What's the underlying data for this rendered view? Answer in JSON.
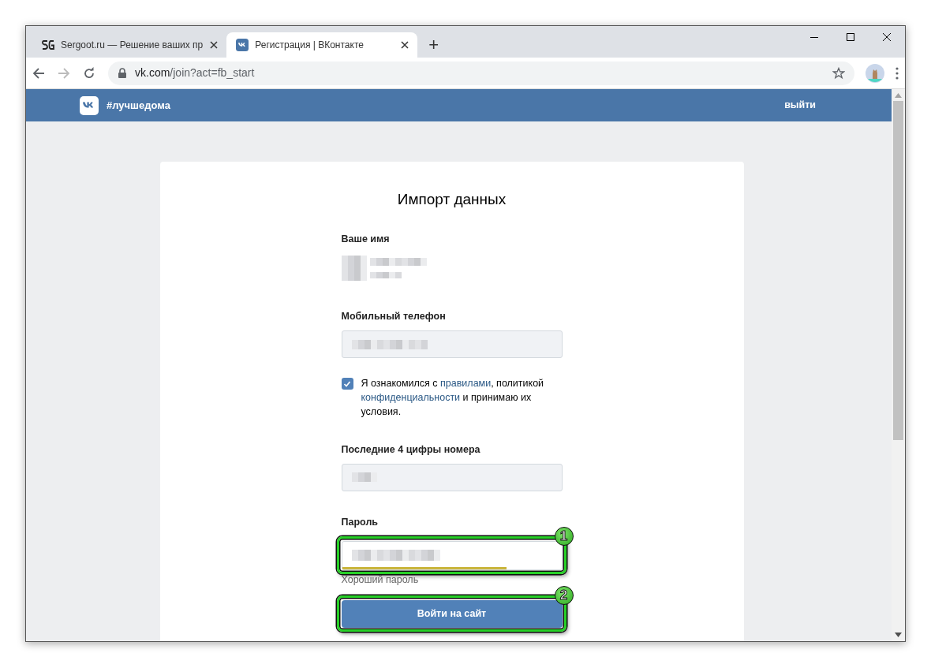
{
  "browser": {
    "tabs": [
      {
        "title": "Sergoot.ru — Решение ваших пр",
        "selected": false,
        "kind": "sg"
      },
      {
        "title": "Регистрация | ВКонтакте",
        "selected": true,
        "kind": "vk"
      }
    ],
    "new_tab": "+",
    "url_host": "vk.com",
    "url_path": "/join?act=fb_start"
  },
  "header": {
    "tag": "#лучшедома",
    "logout": "выйти"
  },
  "form": {
    "title": "Импорт данных",
    "name_label": "Ваше имя",
    "phone_label": "Мобильный телефон",
    "agreement": {
      "checked": true,
      "parts": [
        {
          "kind": "text",
          "text": "Я ознакомился с "
        },
        {
          "kind": "link",
          "text": "правилами"
        },
        {
          "kind": "text",
          "text": ", политикой "
        },
        {
          "kind": "link",
          "text": "конфиденциальности"
        },
        {
          "kind": "text",
          "text": " и принимаю их условия."
        }
      ]
    },
    "last4_label": "Последние 4 цифры номера",
    "password_label": "Пароль",
    "strength": {
      "level": 0.75,
      "color": "#c9b43a",
      "label": "Хороший пароль"
    },
    "submit": "Войти на сайт"
  },
  "annotations": [
    {
      "number": "1"
    },
    {
      "number": "2"
    }
  ]
}
